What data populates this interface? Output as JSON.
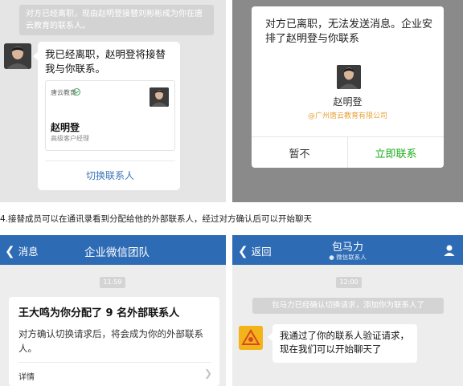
{
  "top_left": {
    "system_notice": "对方已经离职，现由赵明登接替刘彬彬成为你在唐云教育的联系人。",
    "message": "我已经离职，赵明登将接替我与你联系。",
    "card": {
      "org": "唐云教育",
      "verified_icon": "verified-check-icon",
      "name": "赵明登",
      "role": "高级客户经理"
    },
    "switch_button": "切换联系人"
  },
  "top_right": {
    "dialog_text": "对方已离职，无法发送消息。企业安排了赵明登与你联系",
    "name": "赵明登",
    "company": "@广州唐云教育有限公司",
    "cancel_button": "暂不",
    "contact_button": "立即联系"
  },
  "caption": "4.接替成员可以在通讯录看到分配给他的外部联系人，经过对方确认后可以开始聊天",
  "bottom_left": {
    "back": "消息",
    "title": "企业微信团队",
    "time": "11:59",
    "card_title": "王大鸣为你分配了 9 名外部联系人",
    "card_body": "对方确认切换请求后，将会成为你的外部联系人。",
    "detail": "详情"
  },
  "bottom_right": {
    "back": "返回",
    "contact_name": "包马力",
    "contact_sub": "微信联系人",
    "time": "12:00",
    "system_notice": "包马力已经确认切换请求，添加你为联系人了",
    "message": "我通过了你的联系人验证请求，现在我们可以开始聊天了"
  },
  "colors": {
    "header_blue": "#2d6bb5",
    "link_blue": "#3a74b8",
    "wechat_green": "#1aad19",
    "company_orange": "#e8a23a"
  }
}
